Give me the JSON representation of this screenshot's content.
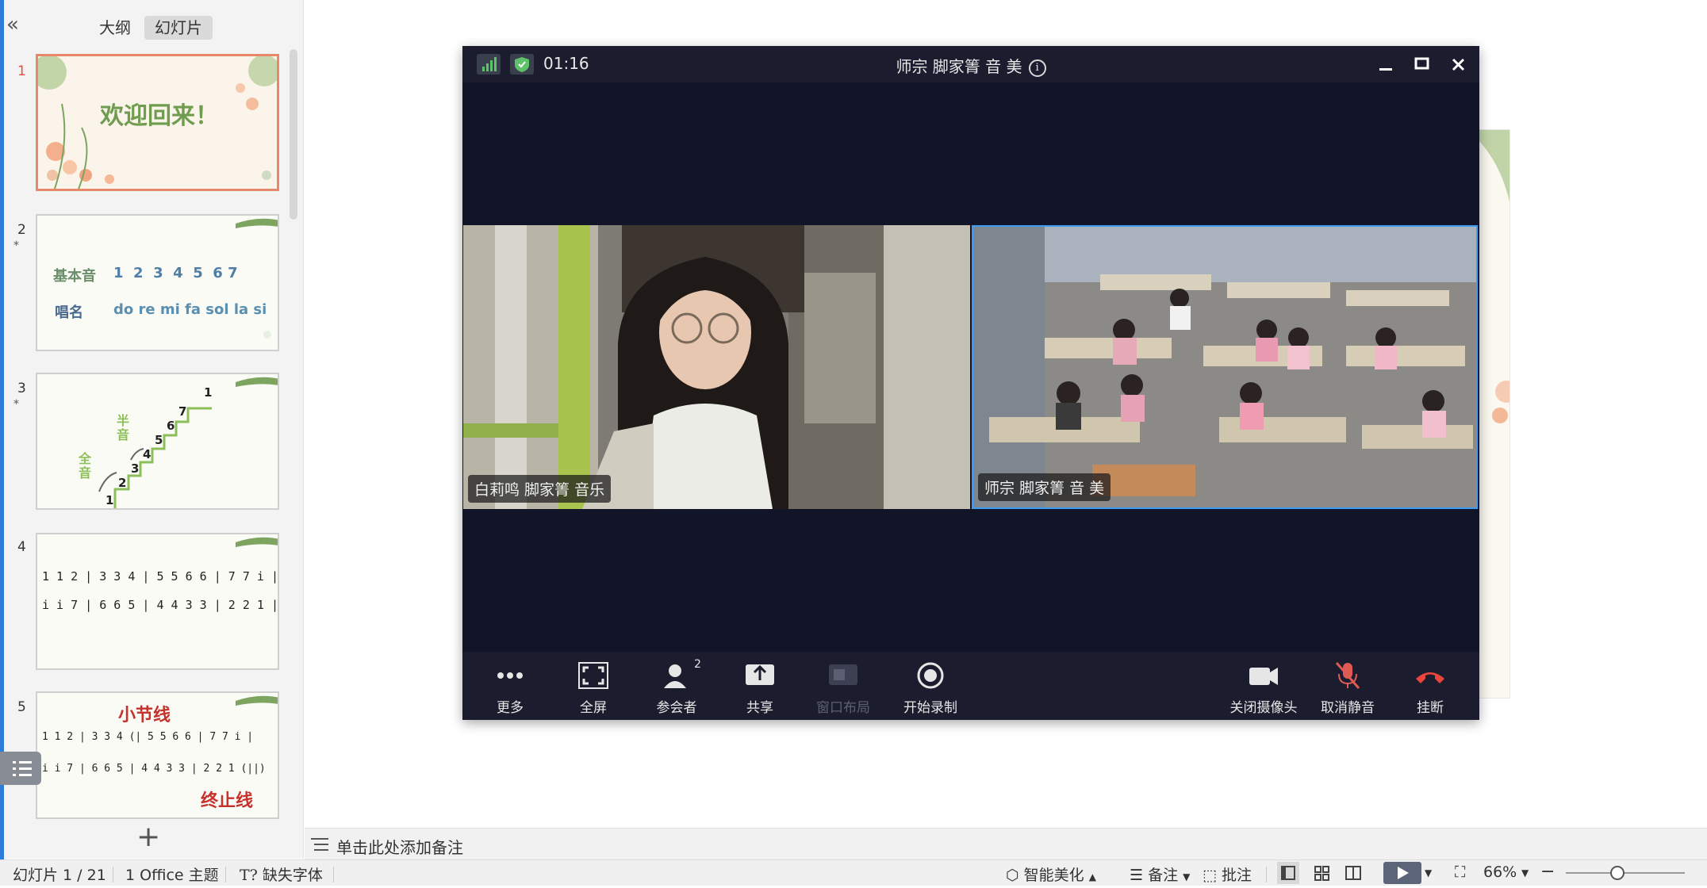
{
  "panel": {
    "tabs": [
      {
        "label": "大纲"
      },
      {
        "label": "幻灯片"
      }
    ],
    "add_button": "+"
  },
  "slides": [
    {
      "num": "1",
      "title": "欢迎回来！"
    },
    {
      "num": "2",
      "star": "*",
      "row1_label": "基本音",
      "row1_values": "1  2  3  4  5  6 7",
      "row2_label": "唱名",
      "row2_values": "do re mi fa sol la si"
    },
    {
      "num": "3",
      "star": "*",
      "steps": [
        "1",
        "2",
        "3",
        "4",
        "5",
        "6",
        "7",
        "1"
      ],
      "label_half": "半音",
      "label_whole": "全音"
    },
    {
      "num": "4",
      "line1": "1 1 2 | 3 3 4 | 5 5 6 6 | 7 7 i |",
      "line2": "i i 7 | 6 6 5 | 4 4 3 3 | 2 2 1 ||"
    },
    {
      "num": "5",
      "label_bar": "小节线",
      "line1": "1 1 2 | 3 3 4 (| 5 5 6 6 | 7 7 i |",
      "line2": "i i 7 | 6 6 5 | 4 4 3 3 | 2 2 1 (||)",
      "label_end": "终止线"
    }
  ],
  "notes": {
    "placeholder": "单击此处添加备注"
  },
  "status": {
    "slide_counter": "幻灯片 1 / 21",
    "theme": "1 Office 主题",
    "missing_font": "缺失字体",
    "beautify": "智能美化",
    "notes_btn": "备注",
    "comment_btn": "批注",
    "zoom": "66%"
  },
  "meeting": {
    "time": "01:16",
    "title": "师宗 脚家箐 音 美",
    "participant_count": "2",
    "participants": [
      {
        "name": "白莉鸣 脚家箐 音乐"
      },
      {
        "name": "师宗 脚家箐 音 美"
      }
    ],
    "toolbar": {
      "more": "更多",
      "fullscreen": "全屏",
      "participants": "参会者",
      "share": "共享",
      "layout": "窗口布局",
      "record": "开始录制",
      "camera_off": "关闭摄像头",
      "unmute": "取消静音",
      "hangup": "挂断"
    }
  },
  "colors": {
    "accent": "#2f7bd9",
    "slide_active_border": "#e98869",
    "meeting_bg": "#121427",
    "hangup_red": "#e8453c",
    "unmute_red": "#e05a54",
    "video_selected": "#3d9df3"
  }
}
